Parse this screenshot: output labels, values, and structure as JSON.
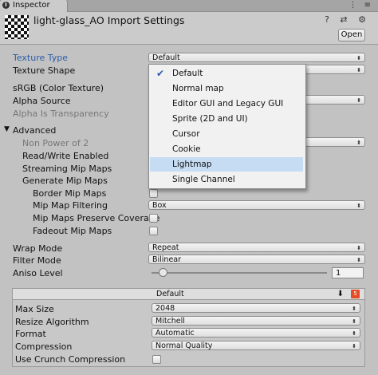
{
  "window": {
    "tab_label": "Inspector",
    "header_icons": "⋮ ≡"
  },
  "header": {
    "title": "light-glass_AO Import Settings",
    "icons": "? ⇄ ⚙",
    "open_label": "Open"
  },
  "fields": {
    "texture_type": {
      "label": "Texture Type",
      "value": "Default"
    },
    "texture_shape": {
      "label": "Texture Shape"
    },
    "srgb": {
      "label": "sRGB (Color Texture)"
    },
    "alpha_source": {
      "label": "Alpha Source"
    },
    "alpha_transparency": {
      "label": "Alpha Is Transparency"
    },
    "advanced": {
      "label": "Advanced"
    },
    "non_power_of_2": {
      "label": "Non Power of 2"
    },
    "read_write": {
      "label": "Read/Write Enabled"
    },
    "streaming_mip": {
      "label": "Streaming Mip Maps"
    },
    "generate_mip": {
      "label": "Generate Mip Maps"
    },
    "border_mip": {
      "label": "Border Mip Maps"
    },
    "mip_filtering": {
      "label": "Mip Map Filtering",
      "value": "Box"
    },
    "mip_preserve": {
      "label": "Mip Maps Preserve Coverage"
    },
    "fadeout_mip": {
      "label": "Fadeout Mip Maps"
    },
    "wrap_mode": {
      "label": "Wrap Mode",
      "value": "Repeat"
    },
    "filter_mode": {
      "label": "Filter Mode",
      "value": "Bilinear"
    },
    "aniso_level": {
      "label": "Aniso Level",
      "value": "1"
    }
  },
  "dropdown_menu": {
    "items": [
      "Default",
      "Normal map",
      "Editor GUI and Legacy GUI",
      "Sprite (2D and UI)",
      "Cursor",
      "Cookie",
      "Lightmap",
      "Single Channel"
    ],
    "checked": "Default",
    "highlighted": "Lightmap"
  },
  "platform": {
    "tab_label": "Default",
    "max_size": {
      "label": "Max Size",
      "value": "2048"
    },
    "resize": {
      "label": "Resize Algorithm",
      "value": "Mitchell"
    },
    "format": {
      "label": "Format",
      "value": "Automatic"
    },
    "compression": {
      "label": "Compression",
      "value": "Normal Quality"
    },
    "crunch": {
      "label": "Use Crunch Compression"
    }
  },
  "glyphs": {
    "dropdown_arrow": "⬍",
    "expanded_triangle": "▼",
    "download": "⬇",
    "html5": "5",
    "check": "✔"
  }
}
